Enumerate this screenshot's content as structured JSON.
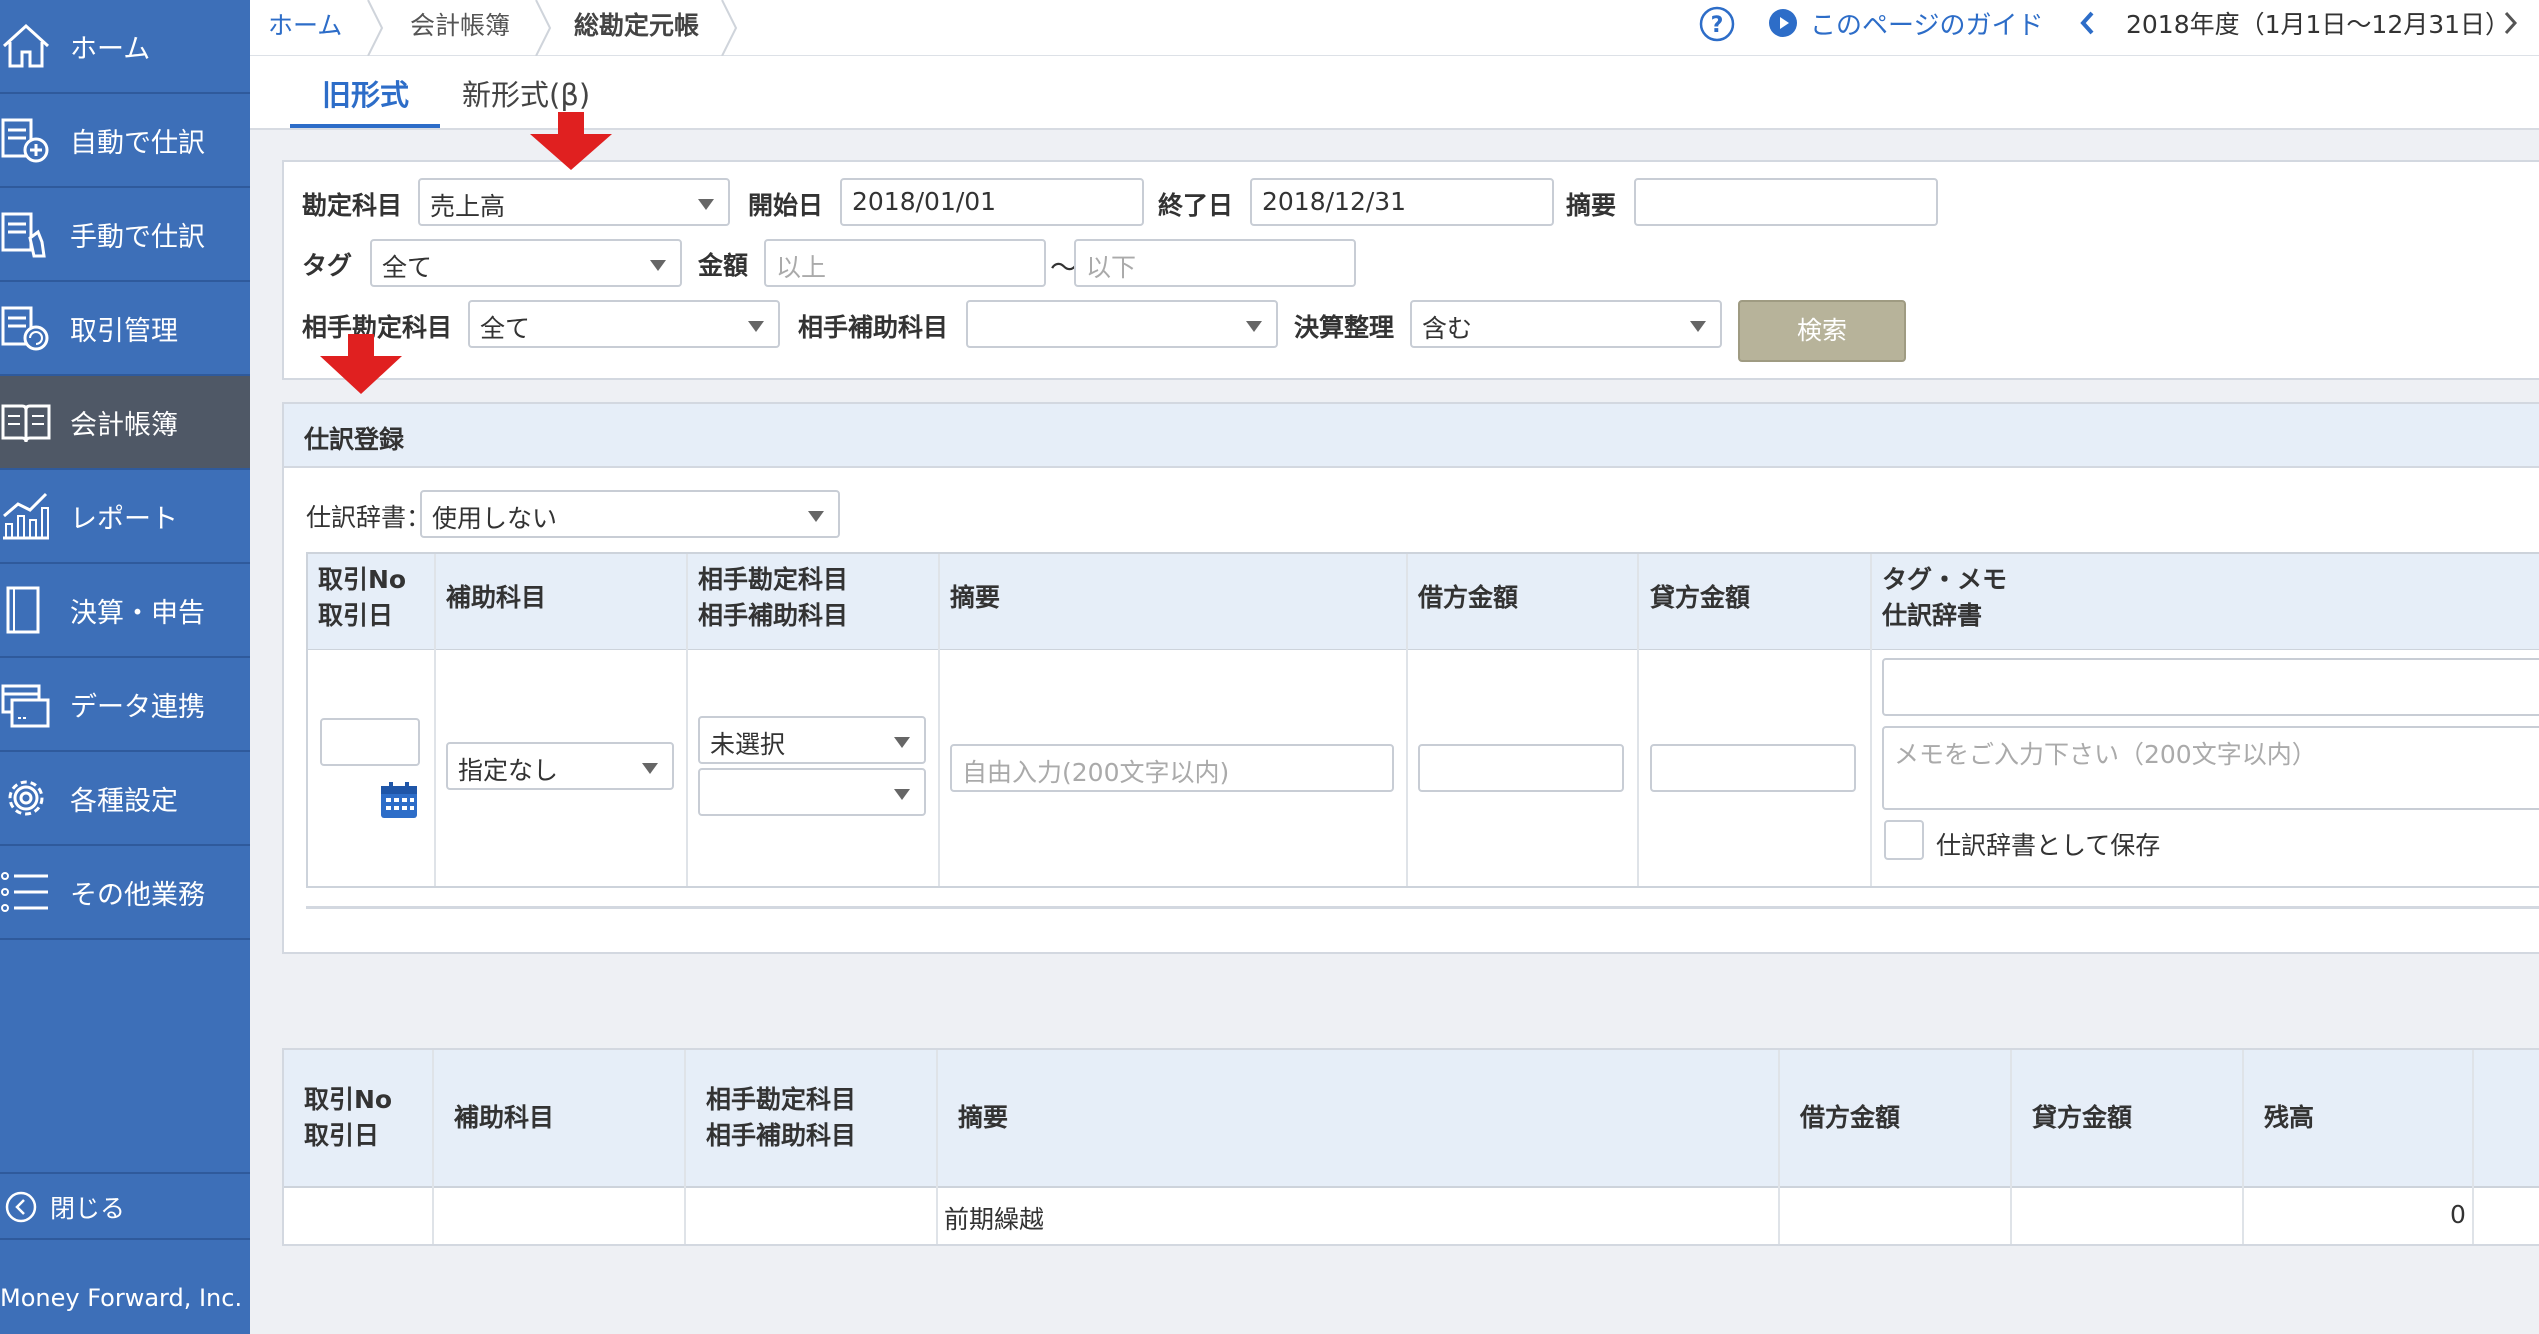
{
  "sidebar": {
    "items": [
      {
        "label": "ホーム",
        "icon": "home-icon"
      },
      {
        "label": "自動で仕訳",
        "icon": "auto-journal-icon"
      },
      {
        "label": "手動で仕訳",
        "icon": "manual-journal-icon"
      },
      {
        "label": "取引管理",
        "icon": "transaction-icon"
      },
      {
        "label": "会計帳簿",
        "icon": "ledger-book-icon",
        "active": true
      },
      {
        "label": "レポート",
        "icon": "report-chart-icon"
      },
      {
        "label": "決算・申告",
        "icon": "settlement-icon"
      },
      {
        "label": "データ連携",
        "icon": "data-link-icon"
      },
      {
        "label": "各種設定",
        "icon": "gear-icon"
      },
      {
        "label": "その他業務",
        "icon": "list-icon"
      }
    ],
    "close_label": "閉じる",
    "company": "Money Forward, Inc.",
    "bg_color": "#3d6fb8"
  },
  "breadcrumb": {
    "home": "ホーム",
    "books": "会計帳簿",
    "current": "総勘定元帳"
  },
  "topbar": {
    "guide": "このページのガイド",
    "fiscal_year": "2018年度（1月1日〜12月31日）"
  },
  "tabs": {
    "old": "旧形式",
    "new": "新形式(β)"
  },
  "search": {
    "account_label": "勘定科目",
    "account_value": "売上高",
    "start_label": "開始日",
    "start_value": "2018/01/01",
    "end_label": "終了日",
    "end_value": "2018/12/31",
    "memo_label": "摘要",
    "memo_value": "",
    "tag_label": "タグ",
    "tag_value": "全て",
    "amount_label": "金額",
    "amount_min_placeholder": "以上",
    "amount_sep": "〜",
    "amount_max_placeholder": "以下",
    "counter_label": "相手勘定科目",
    "counter_value": "全て",
    "counter_sub_label": "相手補助科目",
    "counter_sub_value": "",
    "closing_label": "決算整理",
    "closing_value": "含む",
    "button": "検索"
  },
  "entry": {
    "title": "仕訳登録",
    "dict_label": "仕訳辞書：",
    "dict_value": "使用しない",
    "headers": {
      "no_line1": "取引No",
      "no_line2": "取引日",
      "sub": "補助科目",
      "counter_line1": "相手勘定科目",
      "counter_line2": "相手補助科目",
      "memo": "摘要",
      "debit": "借方金額",
      "credit": "貸方金額",
      "tag_line1": "タグ・メモ",
      "tag_line2": "仕訳辞書"
    },
    "sub_value": "指定なし",
    "counter_value": "未選択",
    "memo_placeholder": "自由入力(200文字以内)",
    "note_placeholder": "メモをご入力下さい（200文字以内）",
    "save_dict_label": "仕訳辞書として保存"
  },
  "ledger": {
    "headers": {
      "no_line1": "取引No",
      "no_line2": "取引日",
      "sub": "補助科目",
      "counter_line1": "相手勘定科目",
      "counter_line2": "相手補助科目",
      "memo": "摘要",
      "debit": "借方金額",
      "credit": "貸方金額",
      "balance": "残高"
    },
    "rows": [
      {
        "memo": "前期繰越",
        "balance": "0"
      }
    ]
  },
  "colors": {
    "accent": "#2d6dc8",
    "annotation_arrow": "#e02020",
    "search_button": "#b7b39a"
  }
}
